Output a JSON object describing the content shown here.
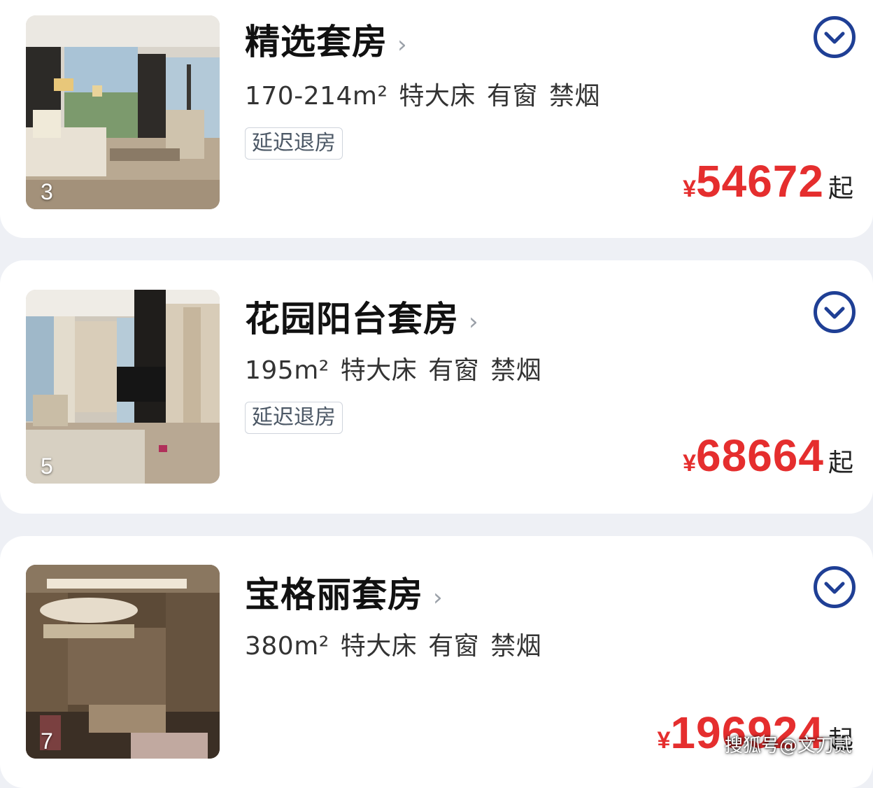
{
  "rooms": [
    {
      "title": "精选套房",
      "photo_count": "3",
      "size": "170-214m²",
      "bed": "特大床",
      "window": "有窗",
      "smoking": "禁烟",
      "tag": "延迟退房",
      "price_currency": "¥",
      "price": "54672",
      "price_suffix": "起"
    },
    {
      "title": "花园阳台套房",
      "photo_count": "5",
      "size": "195m²",
      "bed": "特大床",
      "window": "有窗",
      "smoking": "禁烟",
      "tag": "延迟退房",
      "price_currency": "¥",
      "price": "68664",
      "price_suffix": "起"
    },
    {
      "title": "宝格丽套房",
      "photo_count": "7",
      "size": "380m²",
      "bed": "特大床",
      "window": "有窗",
      "smoking": "禁烟",
      "price_currency": "¥",
      "price": "196924",
      "price_suffix": "起"
    }
  ],
  "icons": {
    "title_chevron": "chevron-right-icon",
    "expand": "chevron-down-circle-icon"
  },
  "colors": {
    "price": "#e52e2e",
    "accent": "#1f3f95",
    "background": "#eef0f5"
  },
  "watermark": "搜狐号@文刀贰"
}
